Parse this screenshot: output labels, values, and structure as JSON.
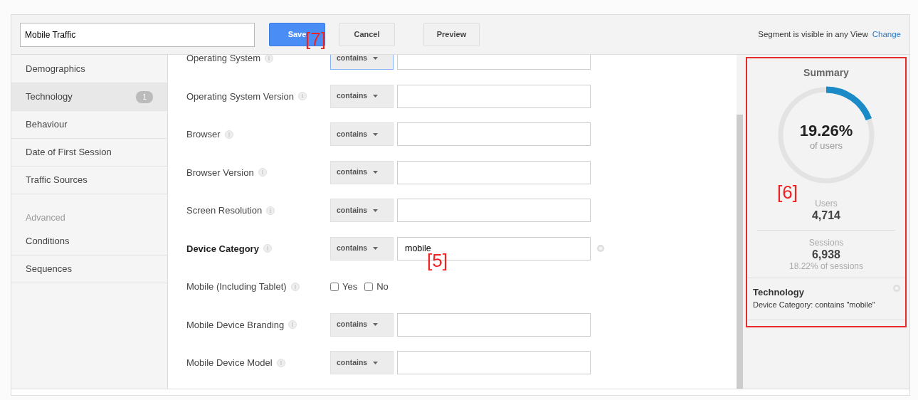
{
  "segment_name": "Mobile Traffic",
  "buttons": [
    {
      "label": "Save",
      "kind": "primary",
      "callout": "[7]"
    },
    {
      "label": "Cancel",
      "kind": "default"
    },
    {
      "label": "Preview",
      "kind": "default"
    }
  ],
  "visibility": {
    "text": "Segment is visible in any View",
    "link": "Change"
  },
  "sidebar": {
    "items": [
      {
        "label": "Demographics",
        "selected": false
      },
      {
        "label": "Technology",
        "selected": true,
        "badge": "1"
      },
      {
        "label": "Behaviour",
        "selected": false
      },
      {
        "label": "Date of First Session",
        "selected": false
      },
      {
        "label": "Traffic Sources",
        "selected": false
      }
    ],
    "advanced_heading": "Advanced",
    "advanced_items": [
      {
        "label": "Conditions",
        "selected": false
      },
      {
        "label": "Sequences",
        "selected": false
      }
    ]
  },
  "conditions": [
    {
      "label": "Operating System",
      "kind": "text",
      "operator": "contains",
      "focused": true,
      "active": false
    },
    {
      "label": "Operating System Version",
      "kind": "text",
      "operator": "contains",
      "focused": false,
      "active": false
    },
    {
      "label": "Browser",
      "kind": "text",
      "operator": "contains",
      "focused": false,
      "active": false
    },
    {
      "label": "Browser Version",
      "kind": "text",
      "operator": "contains",
      "focused": false,
      "active": false
    },
    {
      "label": "Screen Resolution",
      "kind": "text",
      "operator": "contains",
      "focused": false,
      "active": false
    },
    {
      "label": "Device Category",
      "kind": "text",
      "operator": "contains",
      "value": "mobile",
      "focused": false,
      "active": true,
      "callout": "[5]"
    },
    {
      "label": "Mobile (Including Tablet)",
      "kind": "checkbox",
      "options": [
        {
          "label": "Yes",
          "checked": false
        },
        {
          "label": "No",
          "checked": false
        }
      ]
    },
    {
      "label": "Mobile Device Branding",
      "kind": "text",
      "operator": "contains",
      "focused": false,
      "active": false
    },
    {
      "label": "Mobile Device Model",
      "kind": "text",
      "operator": "contains",
      "focused": false,
      "active": false
    }
  ],
  "summary": {
    "title": "Summary",
    "highlighted": true,
    "callout": "[6]",
    "percent": "19.26%",
    "percent_caption": "of users",
    "users_label": "Users",
    "users": "4,714",
    "sessions_label": "Sessions",
    "sessions": "6,938",
    "sessions_caption": "18.22% of sessions",
    "filters": [
      {
        "title": "Technology",
        "text": "Device Category: contains \"mobile\""
      }
    ]
  }
}
